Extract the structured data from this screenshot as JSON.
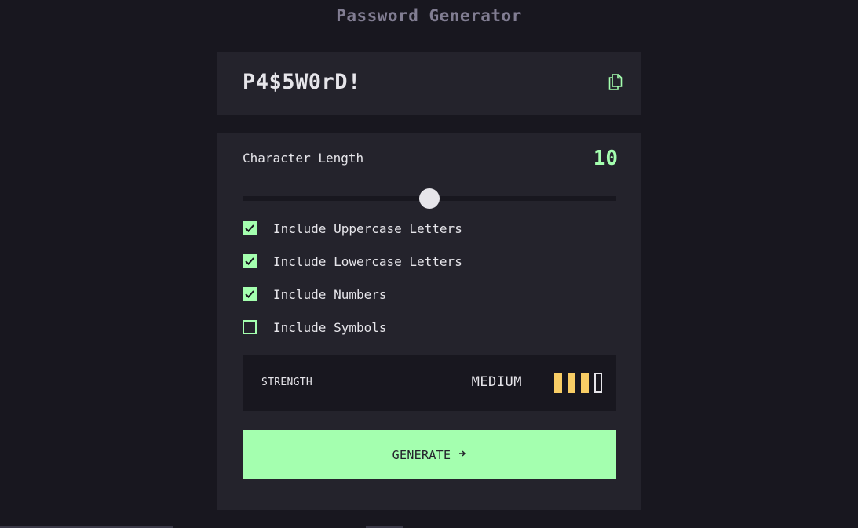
{
  "app": {
    "title": "Password Generator"
  },
  "password": {
    "value": "P4$5W0rD!"
  },
  "length": {
    "label": "Character Length",
    "value": "10",
    "slider_fraction": 0.5
  },
  "options": [
    {
      "label": "Include Uppercase Letters",
      "checked": true
    },
    {
      "label": "Include Lowercase Letters",
      "checked": true
    },
    {
      "label": "Include Numbers",
      "checked": true
    },
    {
      "label": "Include Symbols",
      "checked": false
    }
  ],
  "strength": {
    "label": "STRENGTH",
    "value": "MEDIUM",
    "level": 3,
    "total_bars": 4,
    "color": "#f8cd65"
  },
  "generate": {
    "label": "GENERATE"
  },
  "colors": {
    "accent": "#a4ffaf",
    "background": "#18171f",
    "panel": "#24232c",
    "medium": "#f8cd65"
  },
  "icons": {
    "copy": "copy-icon",
    "check": "check-icon",
    "arrow": "arrow-right-icon"
  }
}
